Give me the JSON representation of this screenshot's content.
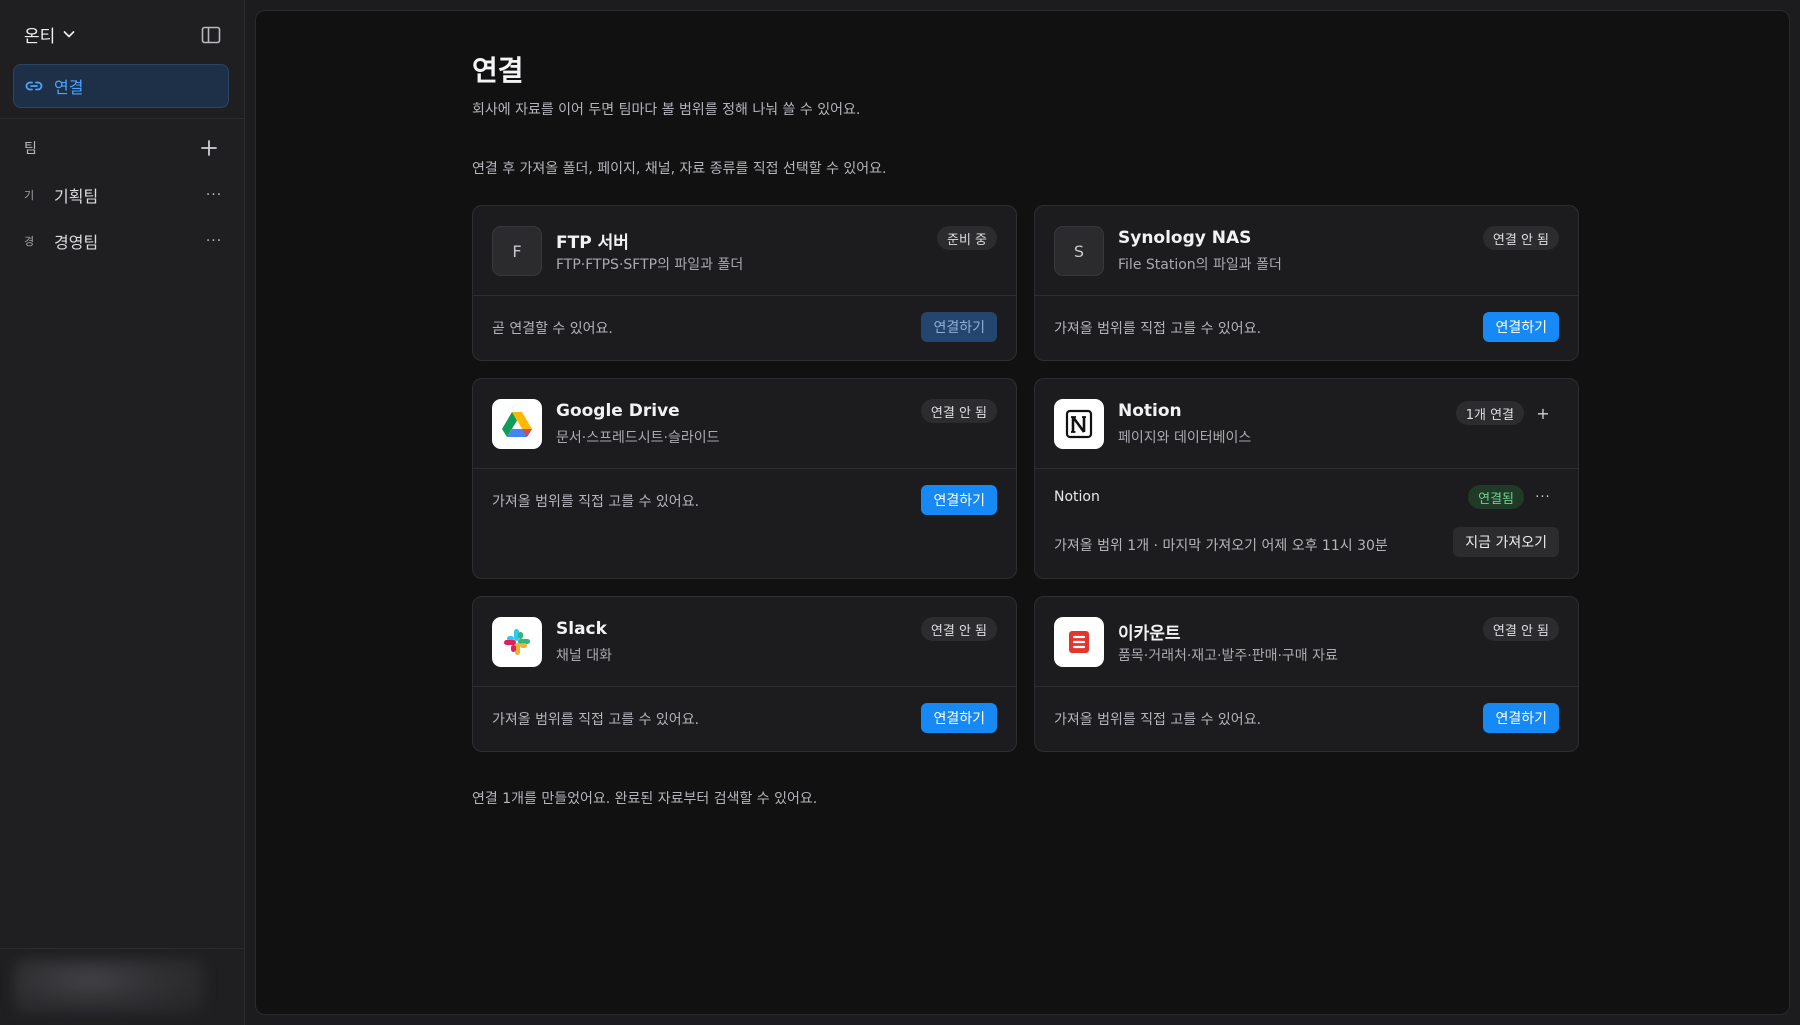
{
  "sidebar": {
    "workspace": "온티",
    "nav_active": "연결",
    "team_section": "팀",
    "teams": [
      {
        "initial": "기",
        "name": "기획팀",
        "more": "···"
      },
      {
        "initial": "경",
        "name": "경영팀",
        "more": "···"
      }
    ]
  },
  "main": {
    "title": "연결",
    "description": "회사에 자료를 이어 두면 팀마다 볼 범위를 정해 나눠 쓸 수 있어요.",
    "note": "연결 후 가져올 폴더, 페이지, 채널, 자료 종류를 직접 선택할 수 있어요.",
    "footer": "연결 1개를 만들었어요. 완료된 자료부터 검색할 수 있어요."
  },
  "cards": {
    "ftp": {
      "icon_letter": "F",
      "name": "FTP 서버",
      "sub": "FTP·FTPS·SFTP의 파일과 폴더",
      "status": "준비 중",
      "bottom": "곧 연결할 수 있어요.",
      "button": "연결하기"
    },
    "synology": {
      "icon_letter": "S",
      "name": "Synology NAS",
      "sub": "File Station의 파일과 폴더",
      "status": "연결 안 됨",
      "bottom": "가져올 범위를 직접 고를 수 있어요.",
      "button": "연결하기"
    },
    "gdrive": {
      "icon": "google-drive-icon",
      "name": "Google Drive",
      "sub": "문서·스프레드시트·슬라이드",
      "status": "연결 안 됨",
      "bottom": "가져올 범위를 직접 고를 수 있어요.",
      "button": "연결하기"
    },
    "notion": {
      "icon": "notion-icon",
      "name": "Notion",
      "sub": "페이지와 데이터베이스",
      "status": "1개 연결",
      "add": "+",
      "conn_name": "Notion",
      "conn_status": "연결됨",
      "conn_more": "···",
      "conn_detail": "가져올 범위 1개 · 마지막 가져오기 어제 오후 11시 30분",
      "sync_button": "지금 가져오기"
    },
    "slack": {
      "icon": "slack-icon",
      "name": "Slack",
      "sub": "채널 대화",
      "status": "연결 안 됨",
      "bottom": "가져올 범위를 직접 고를 수 있어요.",
      "button": "연결하기"
    },
    "ecount": {
      "icon": "ecount-icon",
      "name": "이카운트",
      "sub": "품목·거래처·재고·발주·판매·구매 자료",
      "status": "연결 안 됨",
      "bottom": "가져올 범위를 직접 고를 수 있어요.",
      "button": "연결하기"
    }
  },
  "colors": {
    "accent": "#1689f5",
    "nav_active_text": "#4ba3ff",
    "connected_green": "#6fd08c"
  }
}
